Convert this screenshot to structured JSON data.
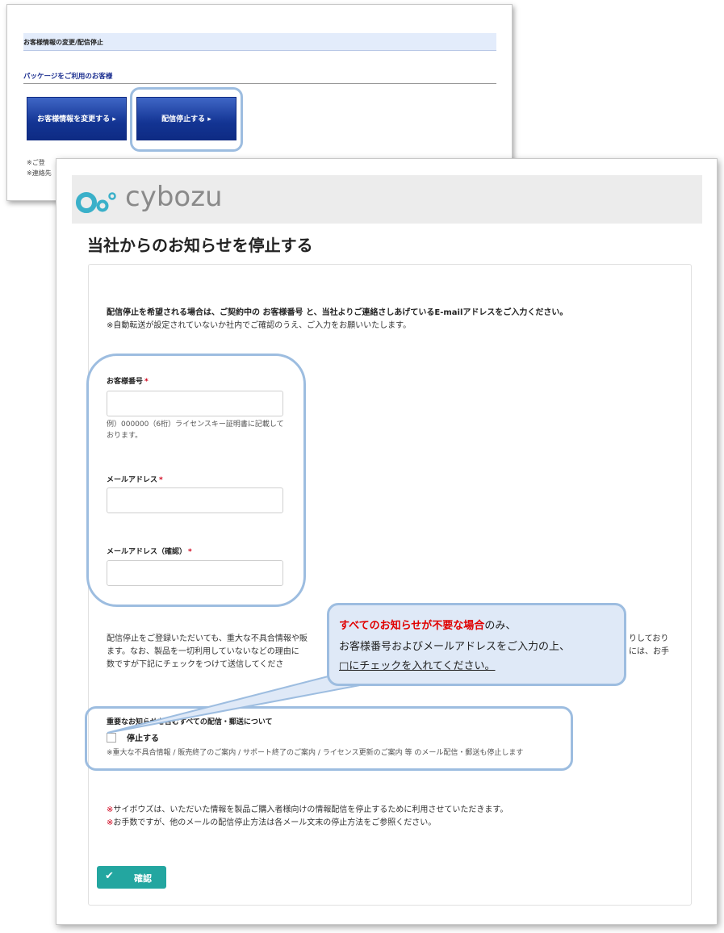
{
  "back_window": {
    "header": "お客様情報の変更/配信停止",
    "subheader": "パッケージをご利用のお客様",
    "change_button": "お客様情報を変更する ▸",
    "stop_button": "配信停止する ▸",
    "note1": "※ご登",
    "note2": "※連絡先"
  },
  "logo": {
    "text": "cybozu",
    "color": "#3ab0c9"
  },
  "page_title": "当社からのお知らせを停止する",
  "intro": {
    "line1": "配信停止を希望される場合は、ご契約中の お客様番号 と、当社よりご連絡さしあげているE-mailアドレスをご入力ください。",
    "line2": "※自動転送が設定されていないか社内でご確認のうえ、ご入力をお願いいたします。"
  },
  "fields": {
    "customer_number_label": "お客様番号",
    "customer_number_value": "",
    "customer_number_hint": "例）000000（6桁）ライセンスキー証明書に記載しております。",
    "email_label": "メールアドレス",
    "email_value": "",
    "email_confirm_label": "メールアドレス（確認）",
    "email_confirm_value": "",
    "required_mark": "*"
  },
  "warning_paragraph": {
    "line1": "配信停止をご登録いただいても、重大な不具合情報や販",
    "line1_end": "りしており",
    "line2": "ます。なお、製品を一切利用していないなどの理由に",
    "line2_end": "には、お手",
    "line3": "数ですが下記にチェックをつけて送信してくださ"
  },
  "stop_section": {
    "heading": "重要なお知らせを含むすべての配信・郵送について",
    "checkbox_label": "停止する",
    "checked": false,
    "note": "※重大な不具合情報 / 販売終了のご案内 / サポート終了のご案内 / ライセンス更新のご案内 等 のメール配信・郵送も停止します"
  },
  "footer_notes": {
    "note1_mark": "※",
    "note1": "サイボウズは、いただいた情報を製品ご購入者様向けの情報配信を停止するために利用させていただきます。",
    "note2_mark": "※",
    "note2": "お手数ですが、他のメールの配信停止方法は各メール文末の停止方法をご参照ください。"
  },
  "confirm_button": {
    "label": "確認",
    "icon": "check-icon"
  },
  "callout": {
    "line1_red": "すべてのお知らせが不要な場合",
    "line1_rest": "のみ、",
    "line2": "お客様番号およびメールアドレスをご入力の上、",
    "line3": "□にチェックを入れてください。"
  },
  "colors": {
    "accent_teal": "#23a6a0",
    "annotation_blue": "#9dbde0",
    "required_red": "#d0021b",
    "button_navy": "#133493"
  }
}
